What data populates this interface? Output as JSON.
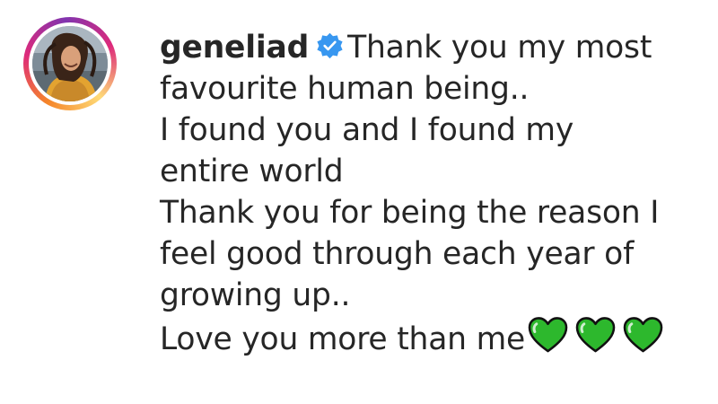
{
  "post": {
    "avatar_icon": "profile-photo",
    "username": "geneliad",
    "verified_icon": "verified-badge-icon",
    "verified_color": "#3897f0",
    "caption_lines": [
      "Thank you my most",
      "favourite human being..",
      "I found you and I found my",
      "entire world",
      "Thank you for being the reason I",
      "feel good through each year of",
      "growing up..",
      "Love you more than me"
    ],
    "heart_icon": "green-heart-emoji",
    "heart_count": 3,
    "heart_color": "#2db82d"
  }
}
